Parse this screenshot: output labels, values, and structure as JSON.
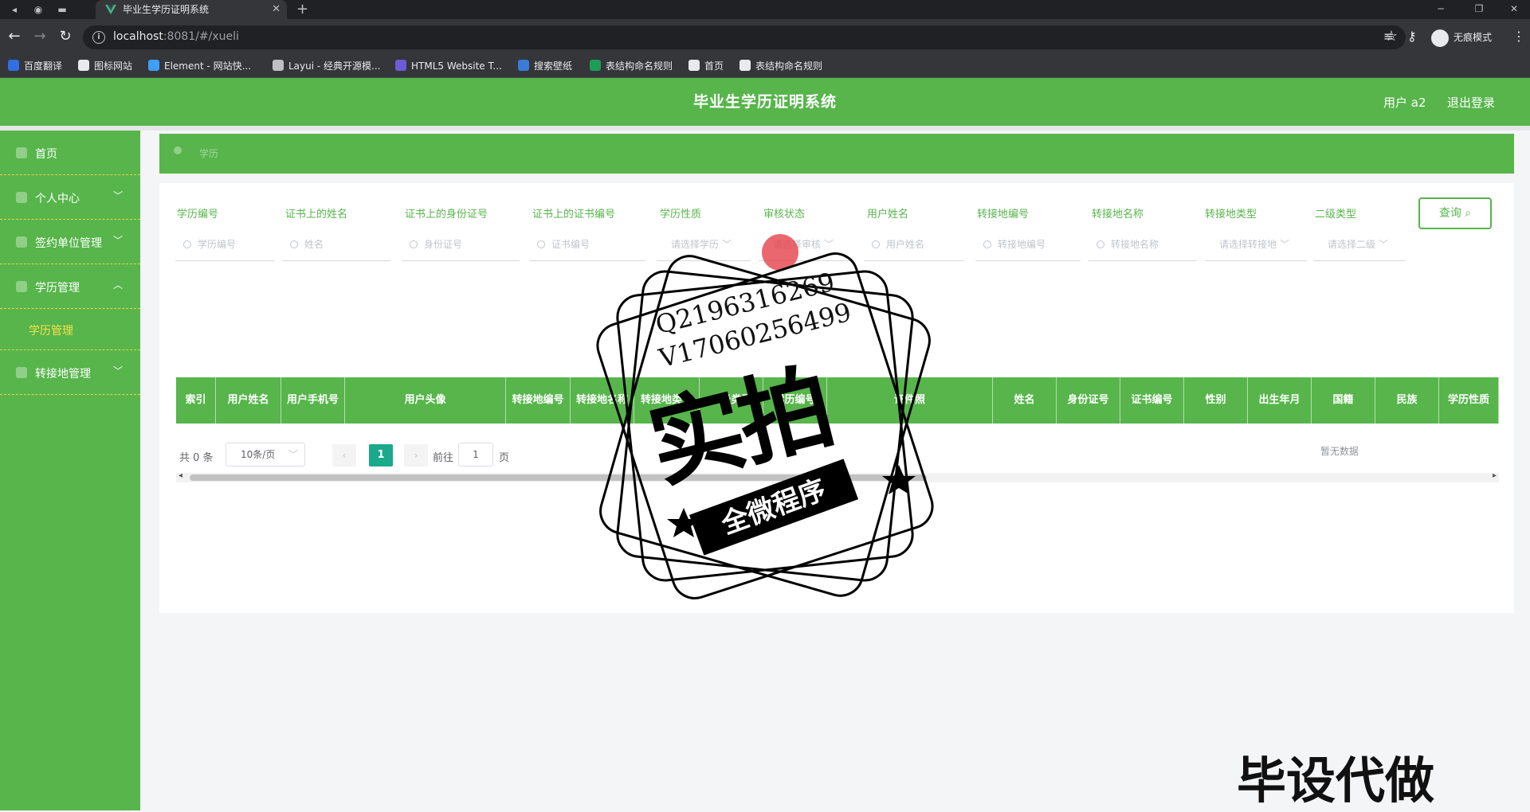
{
  "browser": {
    "tab_title": "毕业生学历证明系统",
    "tab_close": "✕",
    "new_tab": "+",
    "url_host": "localhost",
    "url_rest": ":8081/#/xueli",
    "incognito_label": "无痕模式",
    "bookmarks": [
      {
        "label": "百度翻译",
        "color": "#2f6fe4"
      },
      {
        "label": "图标网站",
        "color": "#e8eaed"
      },
      {
        "label": "Element - 网站快...",
        "color": "#409eff"
      },
      {
        "label": "Layui - 经典开源模...",
        "color": "#bdc1c6"
      },
      {
        "label": "HTML5 Website T...",
        "color": "#6b5cd6"
      },
      {
        "label": "搜索壁纸",
        "color": "#3a7bd5"
      },
      {
        "label": "表结构命名规则",
        "color": "#1e9d58"
      },
      {
        "label": "首页",
        "color": "#e8eaed"
      },
      {
        "label": "表结构命名规则",
        "color": "#e8eaed"
      }
    ]
  },
  "header": {
    "title": "毕业生学历证明系统",
    "user": "用户 a2",
    "logout": "退出登录"
  },
  "sidebar": {
    "items": [
      {
        "label": "首页",
        "arrow": ""
      },
      {
        "label": "个人中心",
        "arrow": "﹀"
      },
      {
        "label": "签约单位管理",
        "arrow": "﹀"
      },
      {
        "label": "学历管理",
        "arrow": "︿"
      },
      {
        "label": "转接地管理",
        "arrow": "﹀"
      }
    ],
    "subitem": "学历管理"
  },
  "breadcrumb": {
    "current": "学历"
  },
  "filters": [
    {
      "label": "学历编号",
      "placeholder": "学历编号",
      "type": "input"
    },
    {
      "label": "证书上的姓名",
      "placeholder": "姓名",
      "type": "input"
    },
    {
      "label": "证书上的身份证号",
      "placeholder": "身份证号",
      "type": "input"
    },
    {
      "label": "证书上的证书编号",
      "placeholder": "证书编号",
      "type": "input"
    },
    {
      "label": "学历性质",
      "placeholder": "请选择学历",
      "type": "select"
    },
    {
      "label": "审核状态",
      "placeholder": "请选择审核",
      "type": "select"
    },
    {
      "label": "用户姓名",
      "placeholder": "用户姓名",
      "type": "input"
    },
    {
      "label": "转接地编号",
      "placeholder": "转接地编号",
      "type": "input"
    },
    {
      "label": "转接地名称",
      "placeholder": "转接地名称",
      "type": "input"
    },
    {
      "label": "转接地类型",
      "placeholder": "请选择转接地",
      "type": "select"
    },
    {
      "label": "二级类型",
      "placeholder": "请选择二级",
      "type": "select"
    }
  ],
  "query_button": "查询",
  "table": {
    "columns": [
      "索引",
      "用户姓名",
      "用户手机号",
      "用户头像",
      "转接地编号",
      "转接地名称",
      "转接地类型",
      "二级类型",
      "学历编号",
      "证件照",
      "姓名",
      "身份证号",
      "证书编号",
      "性别",
      "出生年月",
      "国籍",
      "民族",
      "学历性质"
    ],
    "empty_text": "暂无数据"
  },
  "pagination": {
    "total": "共 0 条",
    "page_size": "10条/页",
    "current_page": "1",
    "goto_prefix": "前往",
    "goto_value": "1",
    "goto_suffix": "页"
  },
  "watermark": {
    "qq": "Q2196316269",
    "v": "V17060256499",
    "big": "实拍",
    "band": "全微程序",
    "bottom": "毕设代做"
  },
  "colors": {
    "brand_green": "#57b54b",
    "active_yellow": "#f5e14a",
    "pager_teal": "#1aa98a"
  }
}
